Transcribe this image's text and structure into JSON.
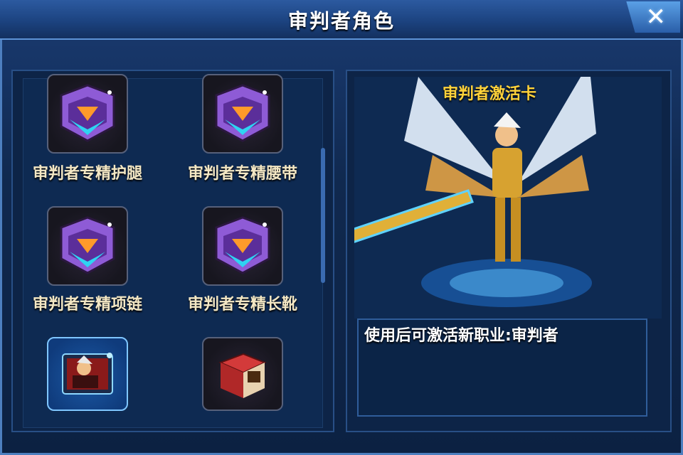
{
  "window": {
    "title": "审判者角色",
    "close_label": "✕"
  },
  "items": [
    {
      "label": "审判者专精护腿",
      "icon": "armor-chest-icon"
    },
    {
      "label": "审判者专精腰带",
      "icon": "armor-chest-icon"
    },
    {
      "label": "审判者专精项链",
      "icon": "armor-chest-icon"
    },
    {
      "label": "审判者专精长靴",
      "icon": "armor-chest-icon"
    },
    {
      "label": "",
      "icon": "character-card-icon",
      "selected": true
    },
    {
      "label": "",
      "icon": "red-book-icon"
    }
  ],
  "preview": {
    "activation_title": "审判者激活卡",
    "description": "使用后可激活新职业:审判者"
  },
  "colors": {
    "accent_gold": "#ffd23a",
    "label_cream": "#f3e7c4",
    "frame_blue": "#1a3b72"
  }
}
